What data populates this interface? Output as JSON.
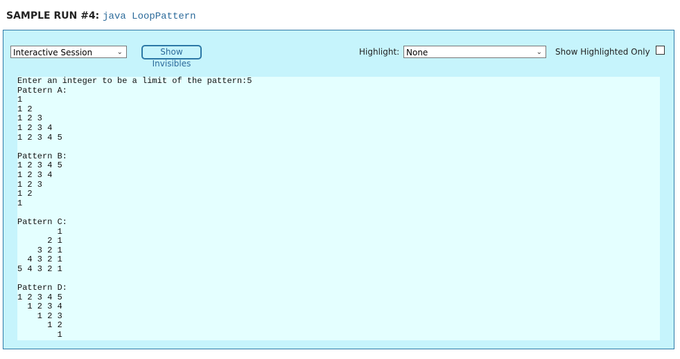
{
  "header": {
    "label": "SAMPLE RUN #4:",
    "command": "java LoopPattern"
  },
  "controls": {
    "session_select": "Interactive Session",
    "show_invisibles": "Show Invisibles",
    "highlight_label": "Highlight:",
    "highlight_select": "None",
    "show_highlighted_only": "Show Highlighted Only",
    "show_highlighted_only_checked": false
  },
  "output": "Enter an integer to be a limit of the pattern:5\nPattern A:\n1\n1 2\n1 2 3\n1 2 3 4\n1 2 3 4 5\n\nPattern B:\n1 2 3 4 5\n1 2 3 4\n1 2 3\n1 2\n1\n\nPattern C:\n        1\n      2 1\n    3 2 1\n  4 3 2 1\n5 4 3 2 1\n\nPattern D:\n1 2 3 4 5\n  1 2 3 4\n    1 2 3\n      1 2\n        1"
}
